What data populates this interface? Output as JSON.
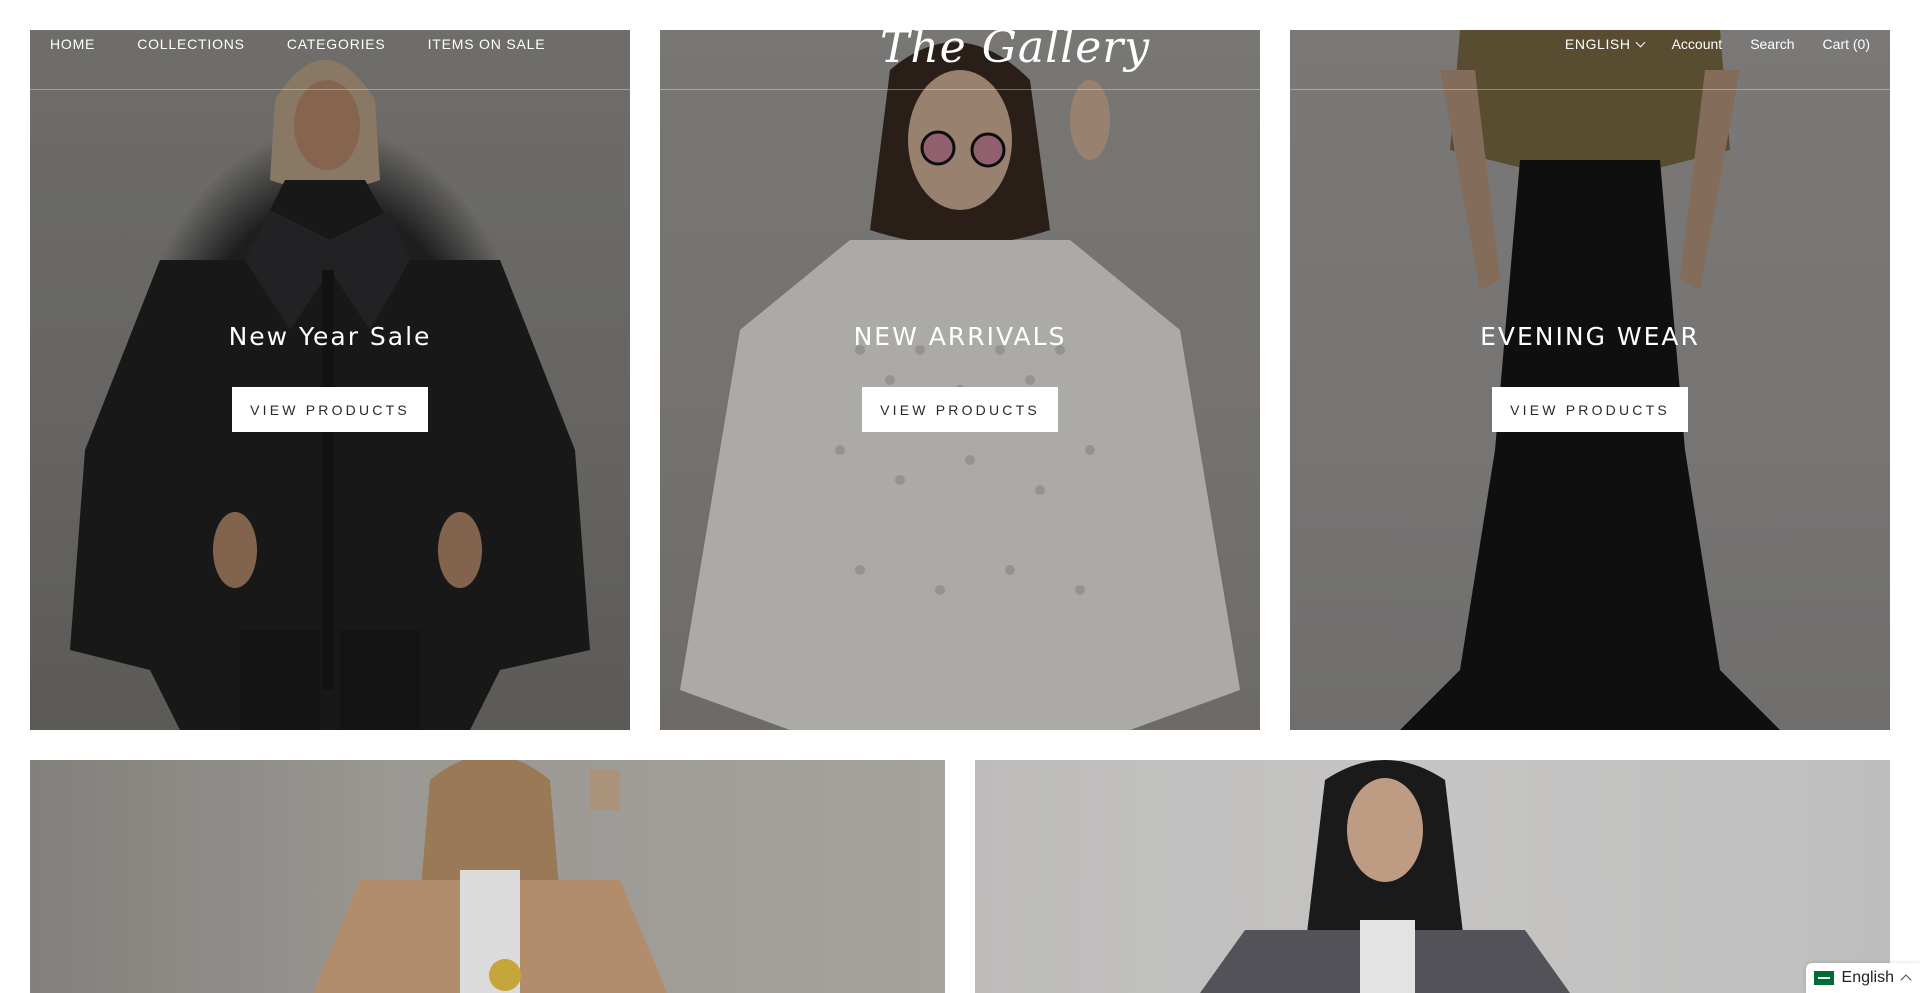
{
  "header": {
    "nav_left": [
      "HOME",
      "COLLECTIONS",
      "CATEGORIES",
      "ITEMS ON SALE"
    ],
    "logo": "The Gallery",
    "language": "ENGLISH",
    "account": "Account",
    "search": "Search",
    "cart": "Cart (0)"
  },
  "tiles": [
    {
      "title": "New Year Sale",
      "button": "VIEW PRODUCTS"
    },
    {
      "title": "NEW ARRIVALS",
      "button": "VIEW PRODUCTS"
    },
    {
      "title": "EVENING WEAR",
      "button": "VIEW PRODUCTS"
    }
  ],
  "language_widget": {
    "label": "English",
    "icon": "flag-icon"
  },
  "colors": {
    "overlay_text": "#ffffff",
    "button_bg": "#ffffff",
    "button_text": "#2a2a2a"
  }
}
